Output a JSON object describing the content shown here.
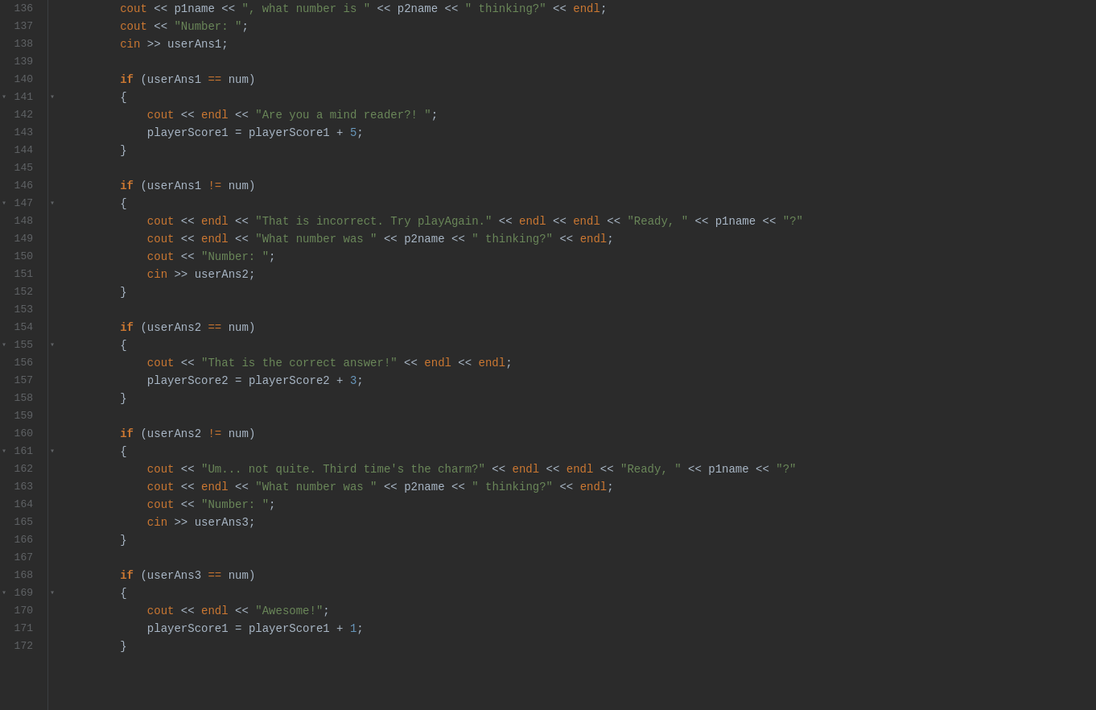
{
  "editor": {
    "background": "#2b2b2b",
    "lineHeight": 22,
    "lines": [
      {
        "num": 136,
        "fold": false,
        "tokens": [
          {
            "t": "        cout << p1name << \", what number is \" << p2name << \" thinking?\" << endl;",
            "c": "mixed136"
          }
        ]
      },
      {
        "num": 137,
        "fold": false,
        "tokens": [
          {
            "t": "        cout << \"Number: \";",
            "c": "mixed137"
          }
        ]
      },
      {
        "num": 138,
        "fold": false,
        "tokens": [
          {
            "t": "        cin >> userAns1;",
            "c": "mixed138"
          }
        ]
      },
      {
        "num": 139,
        "fold": false,
        "tokens": [
          {
            "t": "",
            "c": ""
          }
        ]
      },
      {
        "num": 140,
        "fold": false,
        "tokens": [
          {
            "t": "        if (userAns1 == num)",
            "c": "mixed140"
          }
        ]
      },
      {
        "num": 141,
        "fold": true,
        "tokens": [
          {
            "t": "        {",
            "c": "punc"
          }
        ]
      },
      {
        "num": 142,
        "fold": false,
        "tokens": [
          {
            "t": "            cout << endl << \"Are you a mind reader?! \";",
            "c": "mixed142"
          }
        ]
      },
      {
        "num": 143,
        "fold": false,
        "tokens": [
          {
            "t": "            playerScore1 = playerScore1 + 5;",
            "c": "mixed143"
          }
        ]
      },
      {
        "num": 144,
        "fold": false,
        "tokens": [
          {
            "t": "        }",
            "c": "punc"
          }
        ]
      },
      {
        "num": 145,
        "fold": false,
        "tokens": [
          {
            "t": "",
            "c": ""
          }
        ]
      },
      {
        "num": 146,
        "fold": false,
        "tokens": [
          {
            "t": "        if (userAns1 != num)",
            "c": "mixed146"
          }
        ]
      },
      {
        "num": 147,
        "fold": true,
        "tokens": [
          {
            "t": "        {",
            "c": "punc"
          }
        ]
      },
      {
        "num": 148,
        "fold": false,
        "tokens": [
          {
            "t": "            cout << endl << \"That is incorrect. Try playAgain.\" << endl << endl << \"Ready, \" << p1name << \"?\"",
            "c": "mixed148"
          }
        ]
      },
      {
        "num": 149,
        "fold": false,
        "tokens": [
          {
            "t": "            cout << endl << \"What number was \" << p2name << \" thinking?\" << endl;",
            "c": "mixed149"
          }
        ]
      },
      {
        "num": 150,
        "fold": false,
        "tokens": [
          {
            "t": "            cout << \"Number: \";",
            "c": "mixed150"
          }
        ]
      },
      {
        "num": 151,
        "fold": false,
        "tokens": [
          {
            "t": "            cin >> userAns2;",
            "c": "mixed151"
          }
        ]
      },
      {
        "num": 152,
        "fold": false,
        "tokens": [
          {
            "t": "        }",
            "c": "punc"
          }
        ]
      },
      {
        "num": 153,
        "fold": false,
        "tokens": [
          {
            "t": "",
            "c": ""
          }
        ]
      },
      {
        "num": 154,
        "fold": false,
        "tokens": [
          {
            "t": "        if (userAns2 == num)",
            "c": "mixed154"
          }
        ]
      },
      {
        "num": 155,
        "fold": true,
        "tokens": [
          {
            "t": "        {",
            "c": "punc"
          }
        ]
      },
      {
        "num": 156,
        "fold": false,
        "tokens": [
          {
            "t": "            cout << \"That is the correct answer!\" << endl << endl;",
            "c": "mixed156"
          }
        ]
      },
      {
        "num": 157,
        "fold": false,
        "tokens": [
          {
            "t": "            playerScore2 = playerScore2 + 3;",
            "c": "mixed157"
          }
        ]
      },
      {
        "num": 158,
        "fold": false,
        "tokens": [
          {
            "t": "        }",
            "c": "punc"
          }
        ]
      },
      {
        "num": 159,
        "fold": false,
        "tokens": [
          {
            "t": "",
            "c": ""
          }
        ]
      },
      {
        "num": 160,
        "fold": false,
        "tokens": [
          {
            "t": "        if (userAns2 != num)",
            "c": "mixed160"
          }
        ]
      },
      {
        "num": 161,
        "fold": true,
        "tokens": [
          {
            "t": "        {",
            "c": "punc"
          }
        ]
      },
      {
        "num": 162,
        "fold": false,
        "tokens": [
          {
            "t": "            cout << \"Um... not quite. Third time's the charm?\" << endl << endl << \"Ready, \" << p1name << \"?\"",
            "c": "mixed162"
          }
        ]
      },
      {
        "num": 163,
        "fold": false,
        "tokens": [
          {
            "t": "            cout << endl << \"What number was \" << p2name << \" thinking?\" << endl;",
            "c": "mixed163"
          }
        ]
      },
      {
        "num": 164,
        "fold": false,
        "tokens": [
          {
            "t": "            cout << \"Number: \";",
            "c": "mixed164"
          }
        ]
      },
      {
        "num": 165,
        "fold": false,
        "tokens": [
          {
            "t": "            cin >> userAns3;",
            "c": "mixed165"
          }
        ]
      },
      {
        "num": 166,
        "fold": false,
        "tokens": [
          {
            "t": "        }",
            "c": "punc"
          }
        ]
      },
      {
        "num": 167,
        "fold": false,
        "tokens": [
          {
            "t": "",
            "c": ""
          }
        ]
      },
      {
        "num": 168,
        "fold": false,
        "tokens": [
          {
            "t": "        if (userAns3 == num)",
            "c": "mixed168"
          }
        ]
      },
      {
        "num": 169,
        "fold": true,
        "tokens": [
          {
            "t": "        {",
            "c": "punc"
          }
        ]
      },
      {
        "num": 170,
        "fold": false,
        "tokens": [
          {
            "t": "            cout << endl << \"Awesome!\";",
            "c": "mixed170"
          }
        ]
      },
      {
        "num": 171,
        "fold": false,
        "tokens": [
          {
            "t": "            playerScore1 = playerScore1 + 1;",
            "c": "mixed171"
          }
        ]
      },
      {
        "num": 172,
        "fold": false,
        "tokens": [
          {
            "t": "        }",
            "c": "punc"
          }
        ]
      }
    ]
  }
}
